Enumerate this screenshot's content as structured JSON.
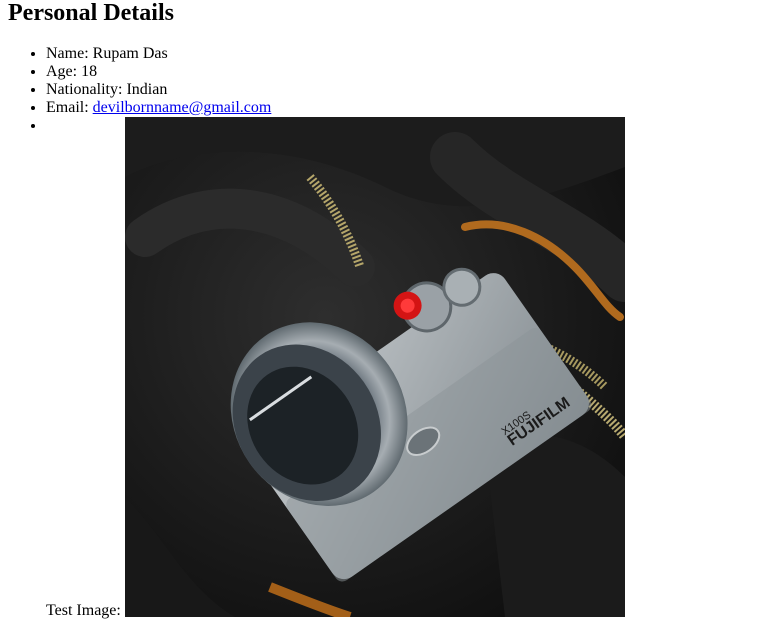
{
  "page": {
    "heading": "Personal Details",
    "details": {
      "name_label": "Name:",
      "name_value": "Rupam Das",
      "age_label": "Age:",
      "age_value": "18",
      "nationality_label": "Nationality:",
      "nationality_value": "Indian",
      "email_label": "Email:",
      "email_value": "devilbornname@gmail.com"
    },
    "image_label": "Test Image:",
    "camera_brand": "FUJIFILM",
    "camera_model": "X100S"
  },
  "colors": {
    "link": "#0000ee",
    "text": "#000000",
    "background": "#ffffff"
  }
}
